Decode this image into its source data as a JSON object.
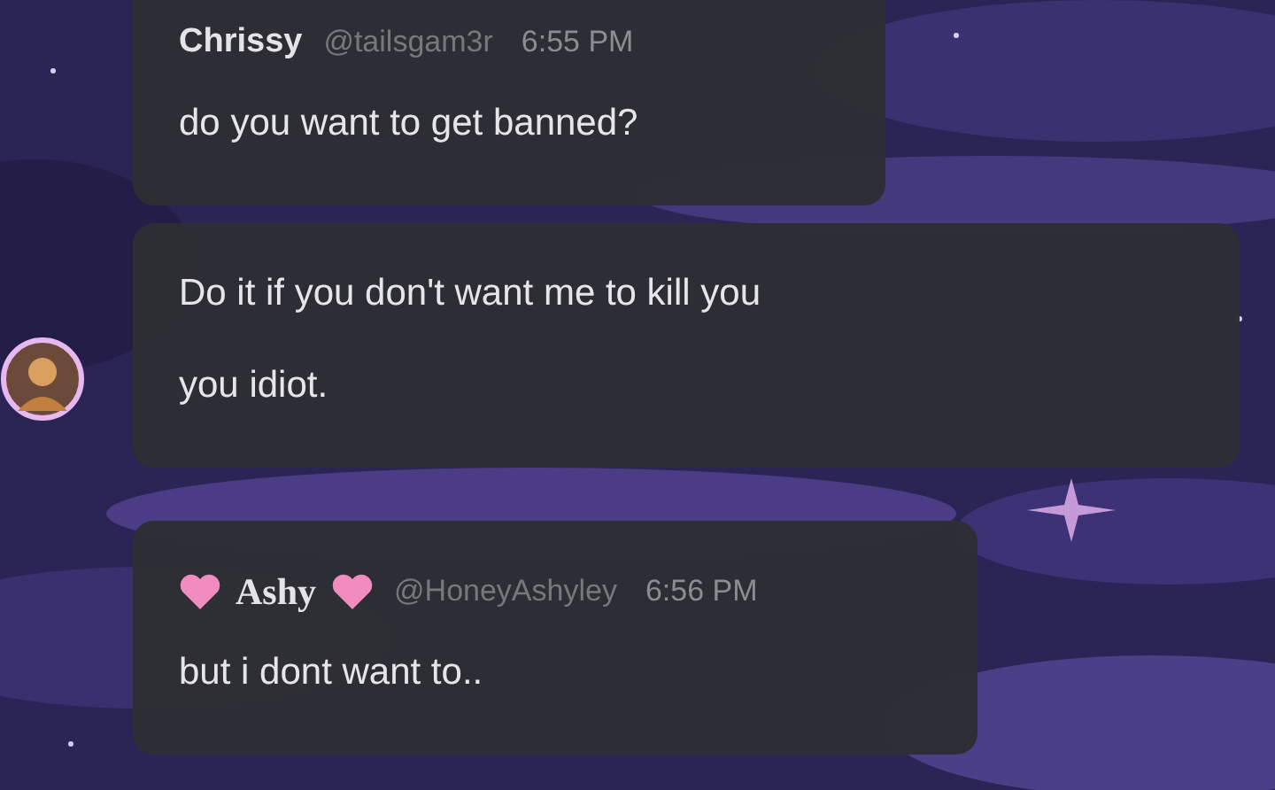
{
  "messages": [
    {
      "kind": "header",
      "author": "Chrissy",
      "decorated": false,
      "handle": "@tailsgam3r",
      "time": "6:55 PM",
      "lines": [
        "do you want to get banned?"
      ]
    },
    {
      "kind": "continuation",
      "avatar": {
        "kind": "picture"
      },
      "lines": [
        "Do it if you don't want me to kill you",
        "you idiot."
      ]
    },
    {
      "kind": "header",
      "author": "Ashy",
      "decorated": true,
      "handle": "@HoneyAshyley",
      "time": "6:56 PM",
      "lines": [
        "but i dont want to.."
      ]
    }
  ]
}
